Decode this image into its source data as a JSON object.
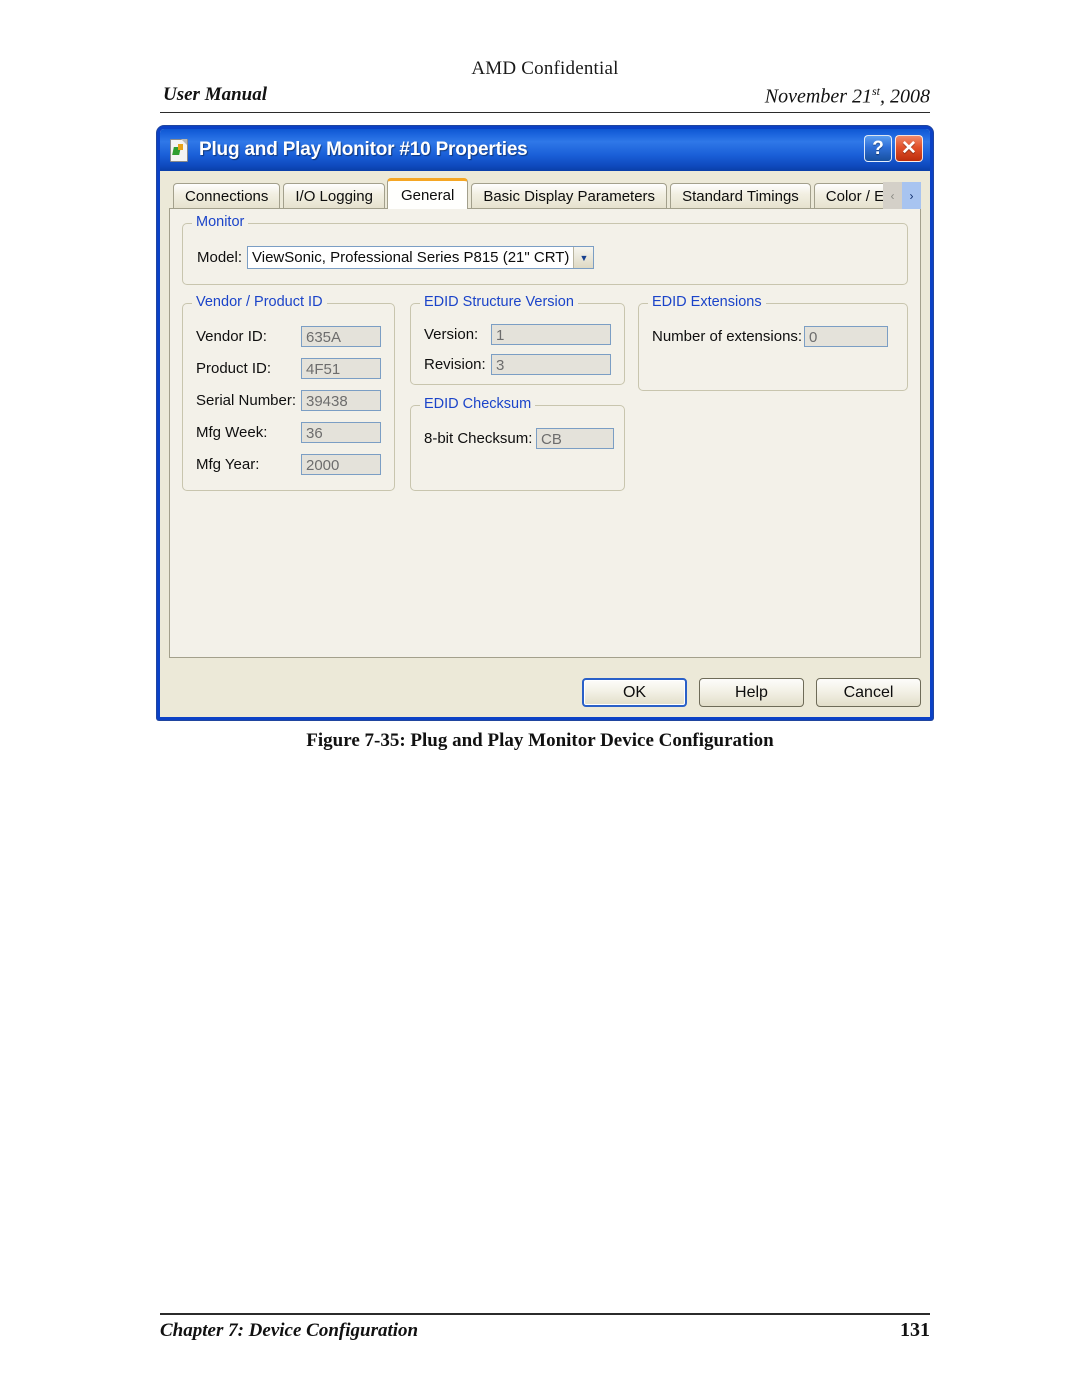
{
  "page": {
    "confidential_notice": "AMD Confidential",
    "header_left": "User Manual",
    "header_right_month_day": "November 21",
    "header_right_ordinal": "st",
    "header_right_year": ", 2008",
    "figure_caption": "Figure 7-35: Plug and Play Monitor Device Configuration",
    "footer_left": "Chapter 7: Device Configuration",
    "footer_page_number": "131"
  },
  "dialog": {
    "title": "Plug and Play Monitor #10 Properties",
    "title_icon": "monitor-properties-icon",
    "help_button_label": "?",
    "close_button_label": "✕",
    "tabs": [
      {
        "label": "Connections",
        "active": false
      },
      {
        "label": "I/O Logging",
        "active": false
      },
      {
        "label": "General",
        "active": true
      },
      {
        "label": "Basic Display Parameters",
        "active": false
      },
      {
        "label": "Standard Timings",
        "active": false
      },
      {
        "label": "Color / E",
        "active": false,
        "clipped": true
      }
    ],
    "tab_scroll": {
      "left_arrow": "‹",
      "right_arrow": "›"
    },
    "groups": {
      "monitor": {
        "legend": "Monitor",
        "model_label": "Model:",
        "model_value": "ViewSonic, Professional Series P815 (21\" CRT)",
        "model_arrow": "▼"
      },
      "vendor_product_id": {
        "legend": "Vendor / Product ID",
        "fields": [
          {
            "label": "Vendor ID:",
            "value": "635A"
          },
          {
            "label": "Product ID:",
            "value": "4F51"
          },
          {
            "label": "Serial Number:",
            "value": "39438"
          },
          {
            "label": "Mfg Week:",
            "value": "36"
          },
          {
            "label": "Mfg Year:",
            "value": "2000"
          }
        ]
      },
      "edid_structure_version": {
        "legend": "EDID Structure Version",
        "fields": [
          {
            "label": "Version:",
            "value": "1"
          },
          {
            "label": "Revision:",
            "value": "3"
          }
        ]
      },
      "edid_checksum": {
        "legend": "EDID Checksum",
        "fields": [
          {
            "label": "8-bit Checksum:",
            "value": "CB"
          }
        ]
      },
      "edid_extensions": {
        "legend": "EDID Extensions",
        "fields": [
          {
            "label": "Number of extensions:",
            "value": "0"
          }
        ]
      }
    },
    "buttons": [
      {
        "label": "OK",
        "default": true
      },
      {
        "label": "Help",
        "default": false
      },
      {
        "label": "Cancel",
        "default": false
      }
    ]
  },
  "colors": {
    "titlebar_blue": "#1b64dd",
    "dialog_border": "#0b41c6",
    "active_tab_accent": "#f5a623",
    "group_legend_blue": "#1b44c9",
    "dialog_face": "#ece9d8",
    "tabpage_face": "#f3f1e9",
    "readonly_field": "#e4e2da",
    "close_button_red": "#e2512a"
  }
}
